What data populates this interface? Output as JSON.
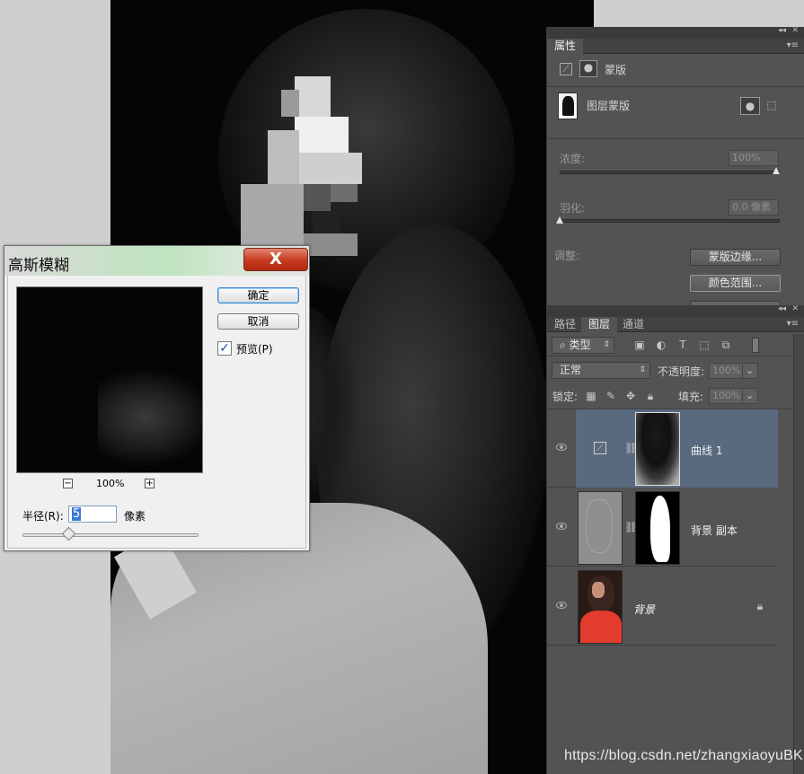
{
  "properties_panel": {
    "tab": "属性",
    "mask_type": "蒙版",
    "layer_mask_label": "图层蒙版",
    "density_label": "浓度:",
    "density_value": "100%",
    "feather_label": "羽化:",
    "feather_value": "0.0 像素",
    "adjust_label": "调整:",
    "mask_edge_button": "蒙版边缘...",
    "color_range_button": "颜色范围..."
  },
  "layers_panel": {
    "tabs": [
      "路径",
      "图层",
      "通道"
    ],
    "active_tab": "图层",
    "filter_kind": "类型",
    "blend_mode": "正常",
    "opacity_label": "不透明度:",
    "opacity_value": "100%",
    "lock_label": "锁定:",
    "fill_label": "填充:",
    "fill_value": "100%",
    "layers": [
      {
        "name": "曲线 1",
        "selected": true
      },
      {
        "name": "背景 副本",
        "selected": false
      },
      {
        "name": "背景",
        "selected": false,
        "locked": true
      }
    ]
  },
  "dialog": {
    "title": "高斯模糊",
    "ok_button": "确定",
    "cancel_button": "取消",
    "preview_label": "预览(P)",
    "preview_checked": true,
    "zoom_value": "100%",
    "zoom_out": "−",
    "zoom_in": "+",
    "radius_label": "半径(R):",
    "radius_value": "5",
    "radius_unit": "像素",
    "close_glyph": "X"
  },
  "watermark": "https://blog.csdn.net/zhangxiaoyuBK",
  "colors": {
    "panel_bg": "#535353",
    "selected_layer": "#596a7f",
    "dialog_close": "#c43a1f"
  }
}
